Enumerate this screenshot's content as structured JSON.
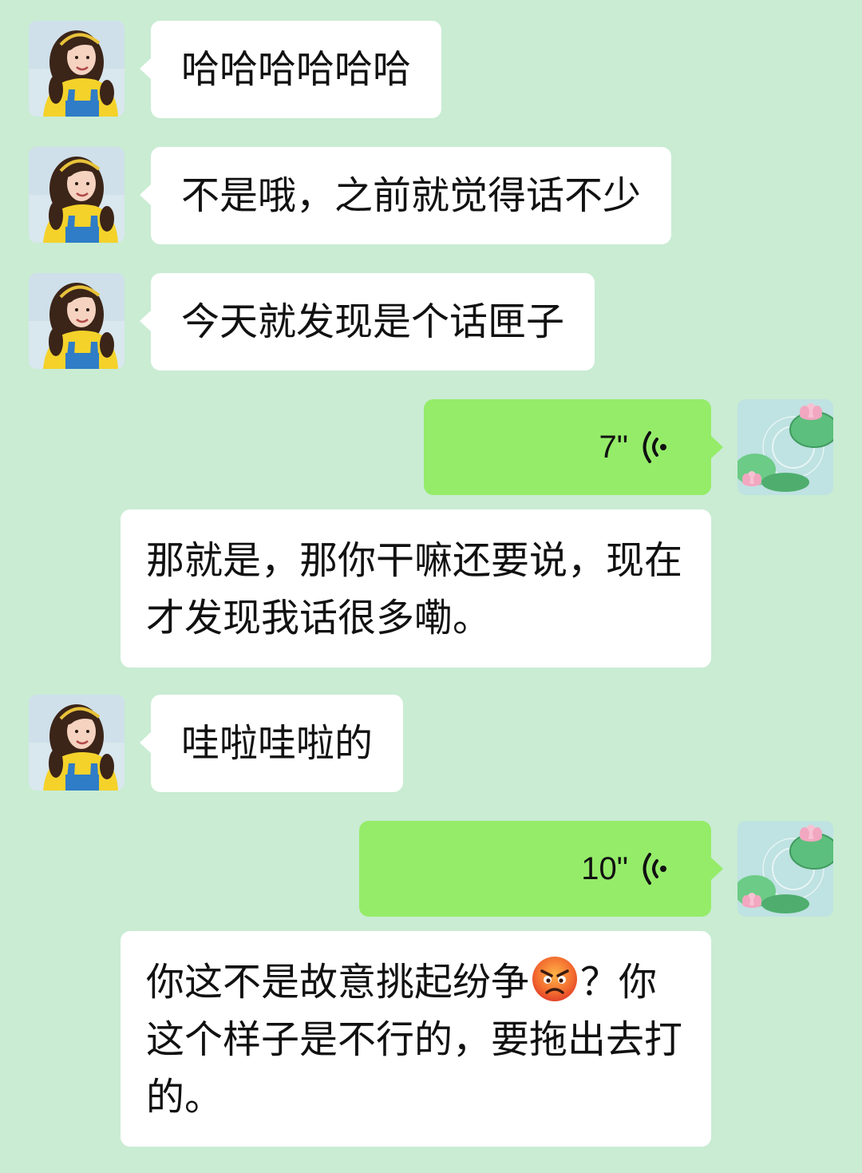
{
  "conversation": {
    "messages": [
      {
        "sender": "other",
        "type": "text",
        "text": "哈哈哈哈哈哈"
      },
      {
        "sender": "other",
        "type": "text",
        "text": "不是哦，之前就觉得话不少"
      },
      {
        "sender": "other",
        "type": "text",
        "text": "今天就发现是个话匣子"
      },
      {
        "sender": "self",
        "type": "voice",
        "duration": "7\"",
        "icon": "voice-wave-icon"
      },
      {
        "sender": "self",
        "type": "text",
        "text": "那就是，那你干嘛还要说，现在才发现我话很多嘞。"
      },
      {
        "sender": "other",
        "type": "text",
        "text": "哇啦哇啦的"
      },
      {
        "sender": "self",
        "type": "voice",
        "duration": "10\"",
        "icon": "voice-wave-icon"
      },
      {
        "sender": "self",
        "type": "text",
        "text_before_emoji": "你这不是故意挑起纷争",
        "emoji": "angry-face",
        "text_after_emoji": "？你这个样子是不行的，要拖出去打的。"
      }
    ]
  },
  "colors": {
    "background": "#c9ecd3",
    "other_bubble": "#ffffff",
    "self_voice_bubble": "#95ec69",
    "text": "#111111"
  }
}
